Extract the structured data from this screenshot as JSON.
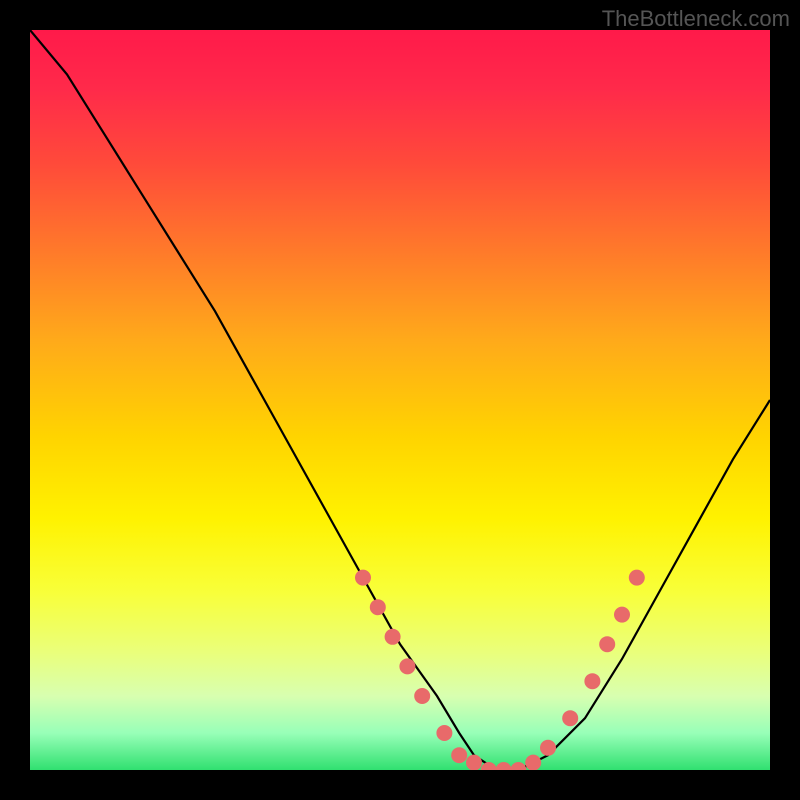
{
  "watermark": "TheBottleneck.com",
  "chart_data": {
    "type": "line",
    "title": "",
    "xlabel": "",
    "ylabel": "",
    "xlim": [
      0,
      100
    ],
    "ylim": [
      0,
      100
    ],
    "series": [
      {
        "name": "curve",
        "x": [
          0,
          5,
          10,
          15,
          20,
          25,
          30,
          35,
          40,
          45,
          50,
          55,
          58,
          60,
          63,
          66,
          70,
          75,
          80,
          85,
          90,
          95,
          100
        ],
        "y": [
          100,
          94,
          86,
          78,
          70,
          62,
          53,
          44,
          35,
          26,
          17,
          10,
          5,
          2,
          0,
          0,
          2,
          7,
          15,
          24,
          33,
          42,
          50
        ]
      }
    ],
    "markers": [
      {
        "x": 45,
        "y": 26
      },
      {
        "x": 47,
        "y": 22
      },
      {
        "x": 49,
        "y": 18
      },
      {
        "x": 51,
        "y": 14
      },
      {
        "x": 53,
        "y": 10
      },
      {
        "x": 56,
        "y": 5
      },
      {
        "x": 58,
        "y": 2
      },
      {
        "x": 60,
        "y": 1
      },
      {
        "x": 62,
        "y": 0
      },
      {
        "x": 64,
        "y": 0
      },
      {
        "x": 66,
        "y": 0
      },
      {
        "x": 68,
        "y": 1
      },
      {
        "x": 70,
        "y": 3
      },
      {
        "x": 73,
        "y": 7
      },
      {
        "x": 76,
        "y": 12
      },
      {
        "x": 78,
        "y": 17
      },
      {
        "x": 80,
        "y": 21
      },
      {
        "x": 82,
        "y": 26
      }
    ],
    "gradient_stops": [
      {
        "pos": 0,
        "color": "#ff1a4a"
      },
      {
        "pos": 55,
        "color": "#ffd400"
      },
      {
        "pos": 100,
        "color": "#30e070"
      }
    ]
  }
}
